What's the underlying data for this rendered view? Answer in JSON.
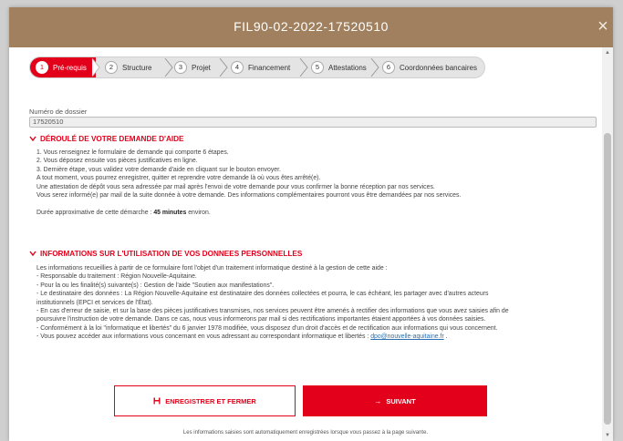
{
  "modal": {
    "title": "FIL90-02-2022-17520510",
    "close_label": "×"
  },
  "steps": [
    {
      "num": "1",
      "label": "Pré-requis"
    },
    {
      "num": "2",
      "label": "Structure"
    },
    {
      "num": "3",
      "label": "Projet"
    },
    {
      "num": "4",
      "label": "Financement"
    },
    {
      "num": "5",
      "label": "Attestations"
    },
    {
      "num": "6",
      "label": "Coordonnées bancaires"
    }
  ],
  "dossier": {
    "label": "Numéro de dossier",
    "value": "17520510"
  },
  "section1": {
    "title": "DÉROULÉ DE VOTRE DEMANDE D'AIDE",
    "lines": [
      "1. Vous renseignez le formulaire de demande qui comporte 6 étapes.",
      "2. Vous déposez ensuite vos pièces justificatives en ligne.",
      "3. Dernière étape, vous validez votre demande d'aide en cliquant sur le bouton envoyer.",
      "A tout moment, vous pourrez enregistrer, quitter et reprendre votre demande là où vous êtes arrêté(e).",
      "Une attestation de dépôt vous sera adressée par mail après l'envoi de votre demande pour vous confirmer la bonne réception par nos services.",
      "Vous serez informé(e) par mail de la suite donnée à votre demande. Des informations complémentaires pourront vous être demandées par nos services."
    ],
    "duration_prefix": "Durée approximative de cette démarche : ",
    "duration_value": "45 minutes",
    "duration_suffix": " environ."
  },
  "section2": {
    "title": "INFORMATIONS SUR L'UTILISATION DE VOS DONNEES PERSONNELLES",
    "lines": [
      "Les informations recueillies à partir de ce formulaire font l'objet d'un traitement informatique destiné à la gestion de cette aide :",
      "- Responsable du traitement : Région Nouvelle-Aquitaine.",
      "- Pour la ou les finalité(s) suivante(s) : Gestion de l'aide \"Soutien aux manifestations\".",
      "- Le destinataire des données : La Région Nouvelle-Aquitaine est destinataire des données collectées et pourra, le cas échéant, les partager avec d'autres acteurs",
      "institutionnels (EPCI et services de l'État).",
      "- En cas d'erreur de saisie, et sur la base des pièces justificatives transmises, nos services peuvent être amenés à rectifier des informations que vous avez saisies afin de",
      "poursuivre l'instruction de votre demande. Dans ce cas, nous vous informerons par mail si des rectifications importantes étaient apportées à vos données saisies.",
      "- Conformément à la loi \"informatique et libertés\" du 6 janvier 1978 modifiée, vous disposez d'un droit d'accès et de rectification aux informations qui vous concernent."
    ],
    "last_line_prefix": "- Vous pouvez accéder aux informations vous concernant en vous adressant au correspondant informatique et libertés : ",
    "email": "dpo@nouvelle-aquitaine.fr",
    "last_line_suffix": " ."
  },
  "buttons": {
    "save_label": "ENREGISTRER ET FERMER",
    "next_label": "SUIVANT"
  },
  "footnote": "Les informations saisies sont automatiquement enregistrées lorsque vous passez à la page suivante.",
  "icons": {
    "save": "save-icon",
    "next": "arrow-right-icon",
    "section": "chevron-down-icon"
  },
  "colors": {
    "accent": "#e2001a",
    "titlebar": "#a0805f"
  }
}
